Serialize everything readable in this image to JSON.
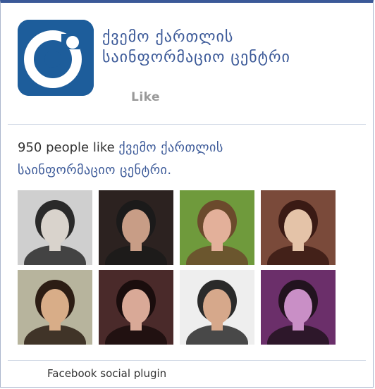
{
  "page": {
    "name_line1": "ქვემო ქართლის",
    "name_line2": "საინფორმაციო ცენტრი",
    "like_label": "Like"
  },
  "fans": {
    "count_text": "950 people like ",
    "page_link_line1": "ქვემო ქართლის",
    "page_link_line2": "საინფორმაციო ცენტრი",
    "page_link_suffix": "."
  },
  "faces": [
    {
      "palette": [
        "#cfcfcf",
        "#2a2a2a",
        "#d9d3cc"
      ]
    },
    {
      "palette": [
        "#2c2220",
        "#1b1a1a",
        "#c89d86"
      ]
    },
    {
      "palette": [
        "#6f9a3c",
        "#6b4a2c",
        "#e3b09a"
      ]
    },
    {
      "palette": [
        "#7a4a3a",
        "#3a1a14",
        "#e4c3a8"
      ]
    },
    {
      "palette": [
        "#b7b49d",
        "#2c1d14",
        "#d8ad88"
      ]
    },
    {
      "palette": [
        "#4a2a2a",
        "#1a0d0d",
        "#d9a997"
      ]
    },
    {
      "palette": [
        "#eeeeee",
        "#2a2a2a",
        "#d6a88b"
      ]
    },
    {
      "palette": [
        "#6b2f6a",
        "#22131f",
        "#c98fc6"
      ]
    }
  ],
  "footer": {
    "text": "Facebook social plugin"
  },
  "colors": {
    "brand": "#3b5998",
    "logo_bg": "#1d5d9b",
    "border": "#aab6cd"
  }
}
